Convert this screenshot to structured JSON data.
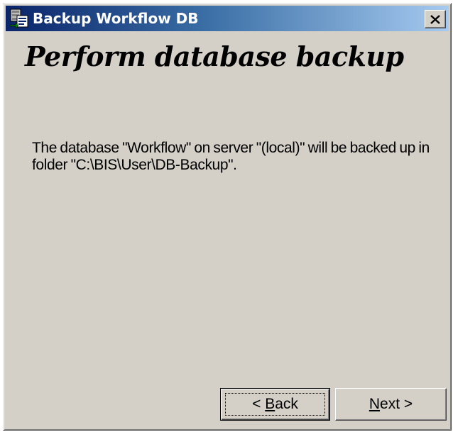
{
  "window": {
    "title": "Backup Workflow DB",
    "close_label": "×"
  },
  "content": {
    "heading": "Perform database backup",
    "message": "The database \"Workflow\" on server \"(local)\" will be backed up in folder \"C:\\BIS\\User\\DB-Backup\"."
  },
  "buttons": {
    "back": {
      "prefix": "< ",
      "mnemonic": "B",
      "rest": "ack"
    },
    "next": {
      "prefix": "",
      "mnemonic": "N",
      "rest": "ext >"
    }
  },
  "icons": {
    "app": "database-backup-icon",
    "close": "close-icon"
  },
  "colors": {
    "titlebar_start": "#0a246a",
    "titlebar_end": "#a6caf0",
    "face": "#d4d0c8"
  }
}
